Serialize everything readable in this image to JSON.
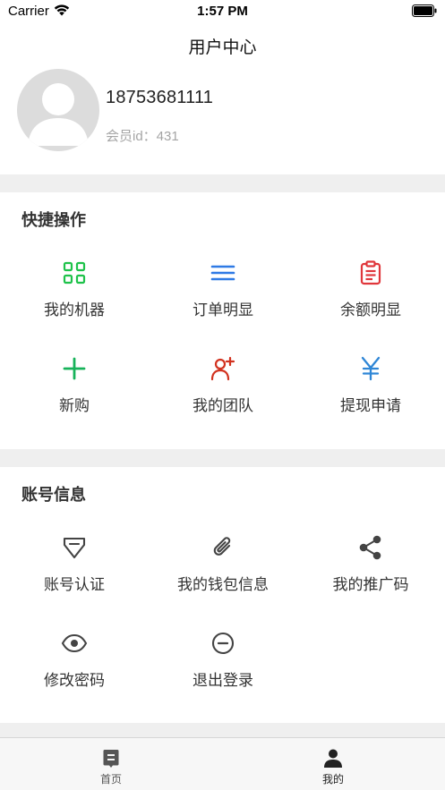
{
  "status_bar": {
    "carrier": "Carrier",
    "time": "1:57 PM"
  },
  "nav": {
    "title": "用户中心"
  },
  "profile": {
    "phone": "18753681111",
    "member_id": "会员id：431"
  },
  "quick_actions": {
    "title": "快捷操作",
    "items": [
      {
        "label": "我的机器",
        "icon": "grid-icon",
        "color": "#1ec24a"
      },
      {
        "label": "订单明显",
        "icon": "list-icon",
        "color": "#2f7ae5"
      },
      {
        "label": "余额明显",
        "icon": "clipboard-icon",
        "color": "#e0363b"
      },
      {
        "label": "新购",
        "icon": "plus-icon",
        "color": "#17b35a"
      },
      {
        "label": "我的团队",
        "icon": "add-person-icon",
        "color": "#d2321f"
      },
      {
        "label": "提现申请",
        "icon": "yen-icon",
        "color": "#2f86d6"
      }
    ]
  },
  "account_info": {
    "title": "账号信息",
    "items": [
      {
        "label": "账号认证",
        "icon": "badge-icon"
      },
      {
        "label": "我的钱包信息",
        "icon": "paperclip-icon"
      },
      {
        "label": "我的推广码",
        "icon": "share-icon"
      },
      {
        "label": "修改密码",
        "icon": "eye-icon"
      },
      {
        "label": "退出登录",
        "icon": "minus-circle-icon"
      }
    ]
  },
  "tabbar": {
    "items": [
      {
        "label": "首页",
        "icon": "home-doc-icon",
        "active": false
      },
      {
        "label": "我的",
        "icon": "person-icon",
        "active": true
      }
    ]
  }
}
